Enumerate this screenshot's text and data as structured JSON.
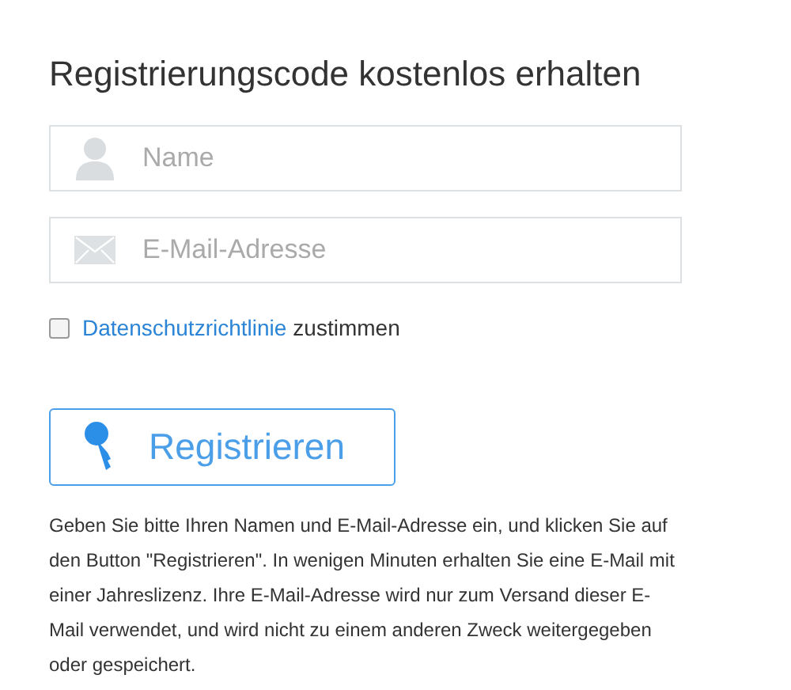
{
  "title": "Registrierungscode kostenlos erhalten",
  "fields": [
    {
      "kind": "name",
      "placeholder": "Name"
    },
    {
      "kind": "email",
      "placeholder": "E-Mail-Adresse"
    }
  ],
  "consent": {
    "checked": false,
    "link": "Datenschutzrichtlinie",
    "text": "zustimmen"
  },
  "button": "Registrieren",
  "info": "Geben Sie bitte Ihren Namen und E-Mail-Adresse ein, und klicken Sie auf den Button \"Registrieren\". In wenigen Minuten erhalten Sie eine E-Mail mit einer Jahreslizenz. Ihre E-Mail-Adresse wird nur zum Versand dieser E-Mail verwendet, und wird nicht zu einem anderen Zweck weitergegeben oder gespeichert."
}
